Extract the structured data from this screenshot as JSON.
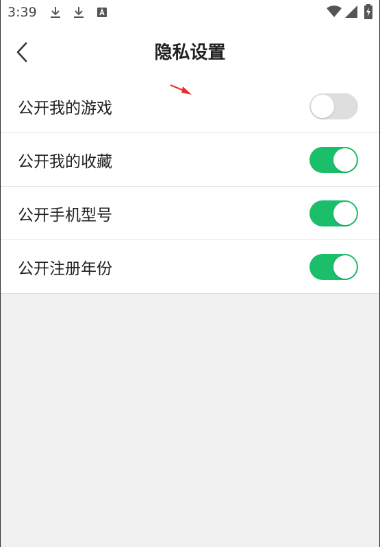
{
  "status_bar": {
    "time": "3:39",
    "icons": [
      "download-icon",
      "download-icon",
      "a-notification-icon",
      "wifi-icon",
      "cell-signal-icon",
      "battery-charging-icon"
    ]
  },
  "header": {
    "title": "隐私设置",
    "back_icon": "chevron-left-icon"
  },
  "settings": [
    {
      "label": "公开我的游戏",
      "enabled": false
    },
    {
      "label": "公开我的收藏",
      "enabled": true
    },
    {
      "label": "公开手机型号",
      "enabled": true
    },
    {
      "label": "公开注册年份",
      "enabled": true
    }
  ],
  "colors": {
    "toggle_on": "#1bbf6a",
    "toggle_off": "#dedede",
    "annotation_arrow": "#e8302a",
    "background": "#f1f1f1"
  }
}
